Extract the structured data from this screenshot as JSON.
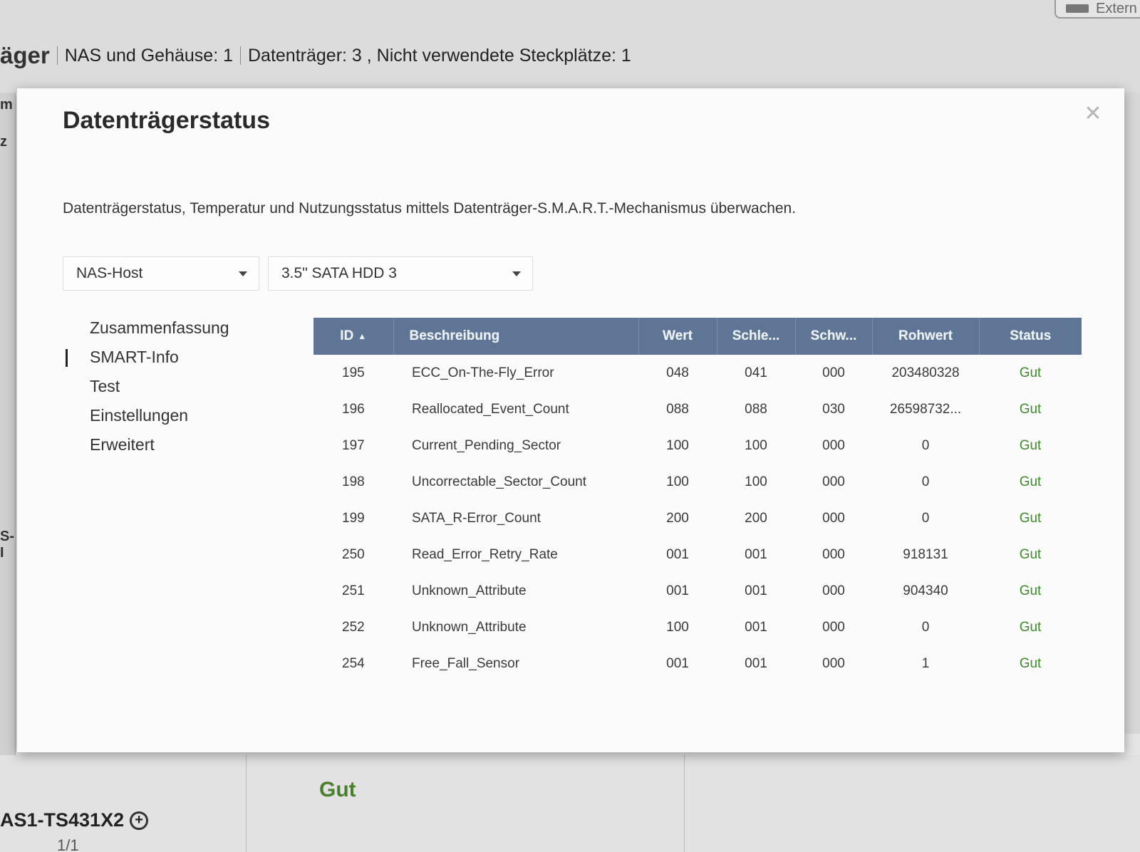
{
  "background": {
    "title_fragment": "äger",
    "summary": {
      "nas_enclosures": "NAS und Gehäuse: 1",
      "disks_and_slots": "Datenträger: 3 , Nicht verwendete Steckplätze: 1"
    },
    "extern_label": "Extern",
    "left_fragments": [
      "m",
      "z",
      "S-I"
    ],
    "status_value": "Gut",
    "device_name": "AS1-TS431X2",
    "page_indicator": "1/1"
  },
  "modal": {
    "title": "Datenträgerstatus",
    "description": "Datenträgerstatus, Temperatur und Nutzungsstatus mittels Datenträger-S.M.A.R.T.-Mechanismus überwachen.",
    "host_select": {
      "value": "NAS-Host"
    },
    "disk_select": {
      "value": "3.5\" SATA HDD 3"
    },
    "nav": [
      {
        "label": "Zusammenfassung",
        "active": false
      },
      {
        "label": "SMART-Info",
        "active": true
      },
      {
        "label": "Test",
        "active": false
      },
      {
        "label": "Einstellungen",
        "active": false
      },
      {
        "label": "Erweitert",
        "active": false
      }
    ],
    "table": {
      "headers": {
        "id": "ID",
        "description": "Beschreibung",
        "value": "Wert",
        "threshold": "Schle...",
        "worst": "Schw...",
        "raw": "Rohwert",
        "status": "Status"
      },
      "rows": [
        {
          "id": "195",
          "description": "ECC_On-The-Fly_Error",
          "value": "048",
          "threshold": "041",
          "worst": "000",
          "raw": "203480328",
          "status": "Gut"
        },
        {
          "id": "196",
          "description": "Reallocated_Event_Count",
          "value": "088",
          "threshold": "088",
          "worst": "030",
          "raw": "26598732...",
          "status": "Gut"
        },
        {
          "id": "197",
          "description": "Current_Pending_Sector",
          "value": "100",
          "threshold": "100",
          "worst": "000",
          "raw": "0",
          "status": "Gut"
        },
        {
          "id": "198",
          "description": "Uncorrectable_Sector_Count",
          "value": "100",
          "threshold": "100",
          "worst": "000",
          "raw": "0",
          "status": "Gut"
        },
        {
          "id": "199",
          "description": "SATA_R-Error_Count",
          "value": "200",
          "threshold": "200",
          "worst": "000",
          "raw": "0",
          "status": "Gut"
        },
        {
          "id": "250",
          "description": "Read_Error_Retry_Rate",
          "value": "001",
          "threshold": "001",
          "worst": "000",
          "raw": "918131",
          "status": "Gut"
        },
        {
          "id": "251",
          "description": "Unknown_Attribute",
          "value": "001",
          "threshold": "001",
          "worst": "000",
          "raw": "904340",
          "status": "Gut"
        },
        {
          "id": "252",
          "description": "Unknown_Attribute",
          "value": "100",
          "threshold": "001",
          "worst": "000",
          "raw": "0",
          "status": "Gut"
        },
        {
          "id": "254",
          "description": "Free_Fall_Sensor",
          "value": "001",
          "threshold": "001",
          "worst": "000",
          "raw": "1",
          "status": "Gut"
        }
      ]
    }
  },
  "colors": {
    "table_header": "#5e7595",
    "status_good": "#3d8a2a"
  }
}
